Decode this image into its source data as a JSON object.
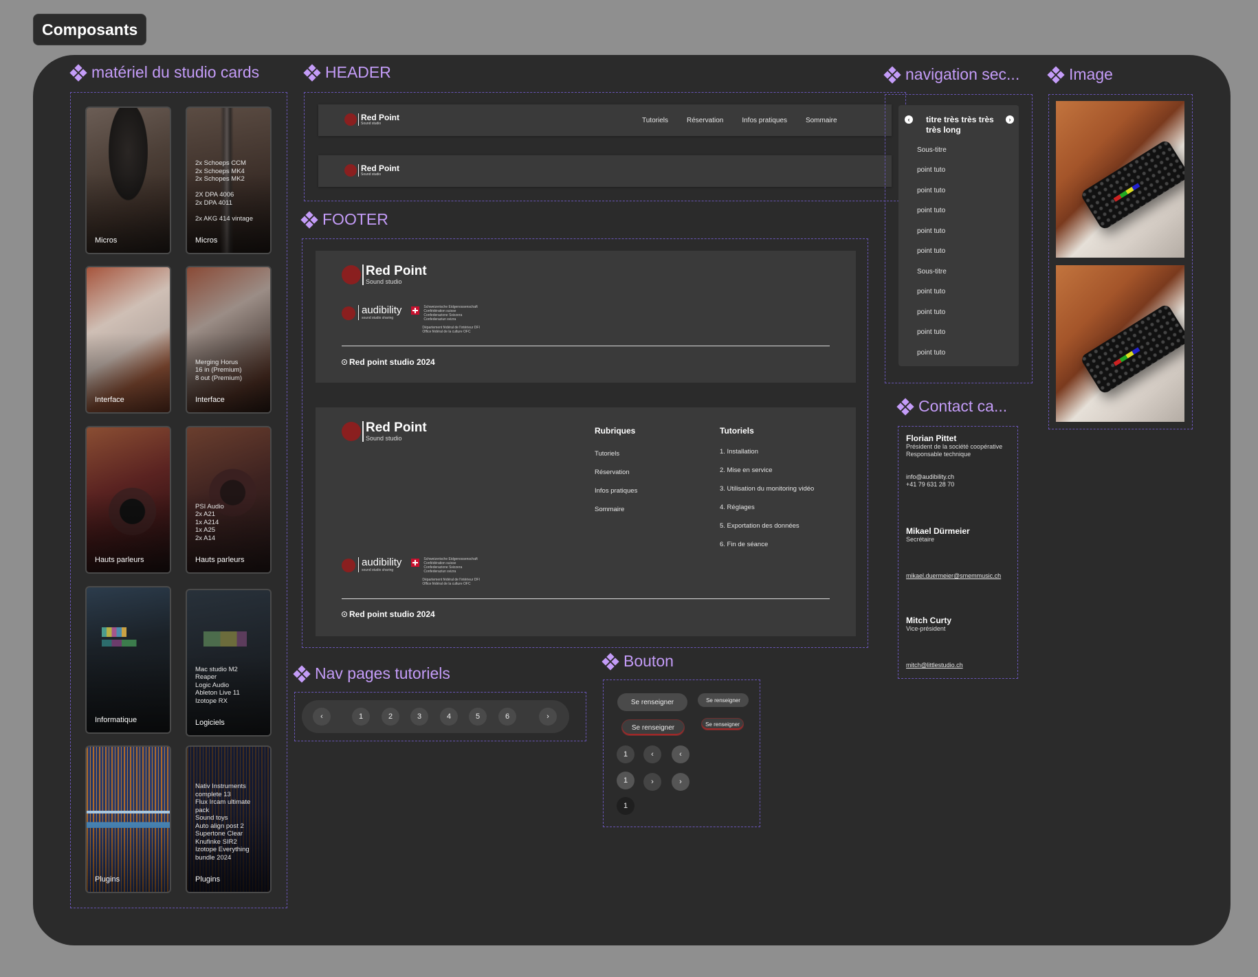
{
  "page_title": "Composants",
  "sections": {
    "cards": "matériel du studio cards",
    "header": "HEADER",
    "footer": "FOOTER",
    "nav_sec": "navigation sec...",
    "image": "Image",
    "contact": "Contact ca...",
    "nav_pages": "Nav pages tutoriels",
    "bouton": "Bouton"
  },
  "cards": [
    {
      "name": "Micros",
      "list": ""
    },
    {
      "name": "Micros",
      "list": "2x Schoeps CCM\n2x Schoeps MK4\n2x Schopes MK2\n\n2X DPA 4006\n2x DPA 4011\n\n2x AKG 414 vintage"
    },
    {
      "name": "Interface",
      "list": ""
    },
    {
      "name": "Interface",
      "list": "Merging Horus\n16 in (Premium)\n8 out (Premium)"
    },
    {
      "name": "Hauts parleurs",
      "list": ""
    },
    {
      "name": "Hauts parleurs",
      "list": "PSI Audio\n2x A21\n1x A214\n1x A25\n2x A14"
    },
    {
      "name": "Informatique",
      "list": ""
    },
    {
      "name": "Logiciels",
      "list": "Mac studio M2\nReaper\nLogic Audio\nAbleton Live 11\nIzotope RX"
    },
    {
      "name": "Plugins",
      "list": ""
    },
    {
      "name": "Plugins",
      "list": "Nativ  Instruments\ncomplete 13\nFlux Ircam ultimate\npack\nSound toys\nAuto align post 2\nSupertone Clear\nKnufinke SIR2\nIzotope Everything\nbundle 2024"
    }
  ],
  "brand": {
    "name": "Red Point",
    "sub": "Sound studio"
  },
  "header_nav": [
    "Tutoriels",
    "Réservation",
    "Infos pratiques",
    "Sommaire"
  ],
  "audibility": {
    "word": "audibility",
    "sub": "sound studio sharing",
    "conf": "Schweizerische Eidgenossenschaft\nConfédération suisse\nConfederazione Svizzera\nConfederaziun svizra",
    "dept": "Département fédéral de l'intérieur DFI\nOffice fédéral de la culture OFC"
  },
  "copyright": "Red point studio 2024",
  "footer_cols": {
    "rubriques_title": "Rubriques",
    "rubriques": [
      "Tutoriels",
      "Réservation",
      "Infos pratiques",
      "Sommaire"
    ],
    "tutoriels_title": "Tutoriels",
    "tutoriels": [
      "1. Installation",
      "2. Mise en service",
      "3. Utilisation du monitoring vidéo",
      "4. Réglages",
      "5. Exportation des données",
      "6. Fin de séance"
    ]
  },
  "section_nav": {
    "title": "titre très très très très long",
    "items": [
      "Sous-titre",
      "point tuto",
      "point tuto",
      "point tuto",
      "point tuto",
      "point tuto",
      "Sous-titre",
      "point tuto",
      "point tuto",
      "point tuto",
      "point tuto"
    ]
  },
  "contacts": [
    {
      "name": "Florian Pittet",
      "role": "Président de la société coopérative\nResponsable technique",
      "mail": "info@audibility.ch\n+41 79 631 28 70"
    },
    {
      "name": "Mikael Dürmeier",
      "role": "Secrétaire",
      "mail": "mikael.duermeier@smemmusic.ch"
    },
    {
      "name": "Mitch Curty",
      "role": "Vice-président",
      "mail": "mitch@littlestudio.ch"
    }
  ],
  "pager": [
    "1",
    "2",
    "3",
    "4",
    "5",
    "6"
  ],
  "buttons": {
    "label": "Se renseigner",
    "num": "1"
  },
  "icons": {
    "prev": "chevron-left-icon",
    "next": "chevron-right-icon"
  },
  "colors": {
    "accent": "#c49cf8",
    "brand_red": "#8a1f1f",
    "board": "#2b2b2b",
    "panel": "#3a3a3a"
  }
}
